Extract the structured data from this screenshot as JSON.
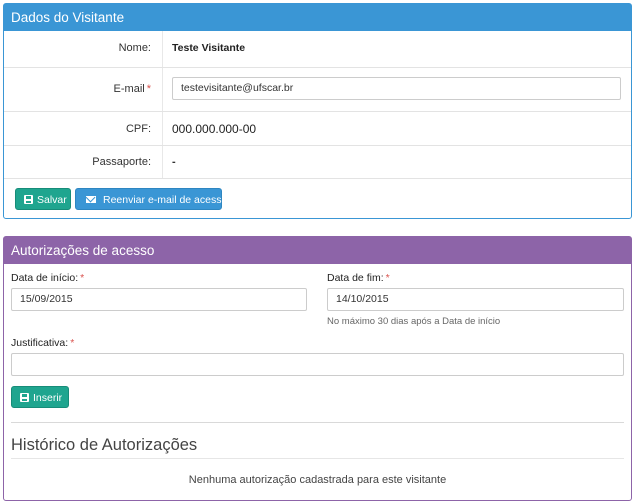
{
  "visitor": {
    "title": "Dados do Visitante",
    "name_label": "Nome:",
    "name_value": "Teste Visitante",
    "email_label": "E-mail",
    "email_value": "testevisitante@ufscar.br",
    "cpf_label": "CPF:",
    "cpf_value": "000.000.000-00",
    "passport_label": "Passaporte:",
    "passport_value": "-",
    "required_mark": "*",
    "save_label": "Salvar",
    "resend_label": "Reenviar e-mail de acesso"
  },
  "access": {
    "title": "Autorizações de acesso",
    "start_label": "Data de início:",
    "start_value": "15/09/2015",
    "end_label": "Data de fim:",
    "end_value": "14/10/2015",
    "end_hint": "No máximo 30 dias após a Data de início",
    "justification_label": "Justificativa:",
    "justification_value": "",
    "required_mark": "*",
    "insert_label": "Inserir"
  },
  "history": {
    "title": "Histórico de Autorizações",
    "empty_message": "Nenhuma autorização cadastrada para este visitante"
  },
  "colors": {
    "visitor_panel": "#3a96d5",
    "access_panel": "#8d64a8",
    "save_button": "#1fa58f",
    "resend_button": "#3a96d5",
    "required": "#d9534f"
  },
  "icons": {
    "save": "floppy-disk-icon",
    "resend": "envelope-icon",
    "insert": "floppy-disk-icon"
  }
}
